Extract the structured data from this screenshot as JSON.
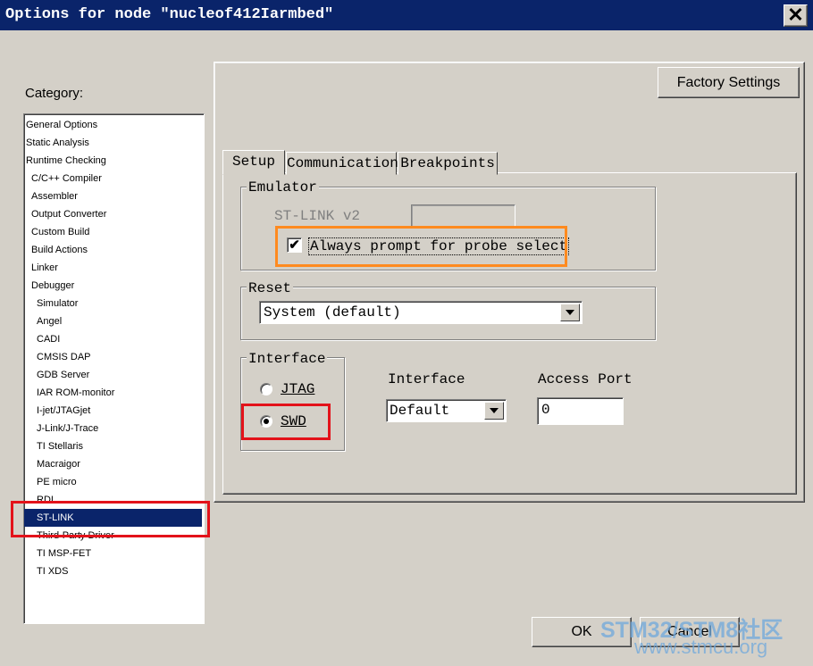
{
  "window": {
    "title": "Options for node \"nucleof412Iarmbed\""
  },
  "category": {
    "label": "Category:",
    "items": [
      {
        "label": "General Options",
        "indent": 0
      },
      {
        "label": "Static Analysis",
        "indent": 0
      },
      {
        "label": "Runtime Checking",
        "indent": 0
      },
      {
        "label": "C/C++ Compiler",
        "indent": 1
      },
      {
        "label": "Assembler",
        "indent": 1
      },
      {
        "label": "Output Converter",
        "indent": 1
      },
      {
        "label": "Custom Build",
        "indent": 1
      },
      {
        "label": "Build Actions",
        "indent": 1
      },
      {
        "label": "Linker",
        "indent": 1
      },
      {
        "label": "Debugger",
        "indent": 1
      },
      {
        "label": "Simulator",
        "indent": 2
      },
      {
        "label": "Angel",
        "indent": 2
      },
      {
        "label": "CADI",
        "indent": 2
      },
      {
        "label": "CMSIS DAP",
        "indent": 2
      },
      {
        "label": "GDB Server",
        "indent": 2
      },
      {
        "label": "IAR ROM-monitor",
        "indent": 2
      },
      {
        "label": "I-jet/JTAGjet",
        "indent": 2
      },
      {
        "label": "J-Link/J-Trace",
        "indent": 2
      },
      {
        "label": "TI Stellaris",
        "indent": 2
      },
      {
        "label": "Macraigor",
        "indent": 2
      },
      {
        "label": "PE micro",
        "indent": 2
      },
      {
        "label": "RDI",
        "indent": 2
      },
      {
        "label": "ST-LINK",
        "indent": 2,
        "selected": true
      },
      {
        "label": "Third-Party Driver",
        "indent": 2
      },
      {
        "label": "TI MSP-FET",
        "indent": 2
      },
      {
        "label": "TI XDS",
        "indent": 2
      }
    ]
  },
  "factory_settings": "Factory Settings",
  "tabs": [
    {
      "label": "Setup",
      "active": true
    },
    {
      "label": "Communication",
      "active": false
    },
    {
      "label": "Breakpoints",
      "active": false
    }
  ],
  "emulator": {
    "legend": "Emulator",
    "device_label": "ST-LINK v2",
    "always_prompt_label": "Always prompt for probe select",
    "always_prompt_checked": true
  },
  "reset": {
    "legend": "Reset",
    "value": "System (default)"
  },
  "interface_group": {
    "legend": "Interface",
    "options": [
      {
        "label": "JTAG",
        "selected": false
      },
      {
        "label": "SWD",
        "selected": true
      }
    ]
  },
  "interface_select": {
    "label": "Interface",
    "value": "Default"
  },
  "access_port": {
    "label": "Access Port",
    "value": "0"
  },
  "buttons": {
    "ok": "OK",
    "cancel": "Cancel"
  },
  "watermark": {
    "line1": "STM32/STM8社区",
    "line2": "www.stmcu.org"
  },
  "colors": {
    "titlebar": "#0a246a",
    "highlight_orange": "#ff8a1f",
    "highlight_red": "#e3121a",
    "watermark": "#6fa8dc"
  }
}
